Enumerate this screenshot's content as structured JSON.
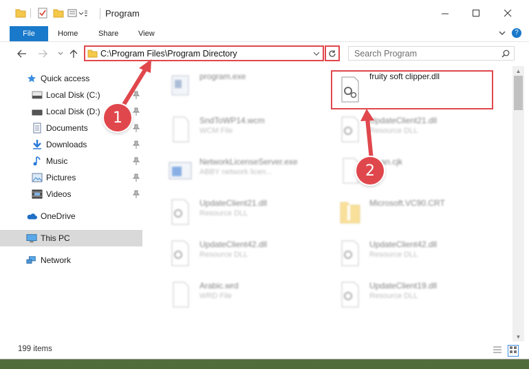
{
  "window": {
    "title": "Program"
  },
  "ribbon": {
    "tabs": [
      {
        "label": "File"
      },
      {
        "label": "Home"
      },
      {
        "label": "Share"
      },
      {
        "label": "View"
      }
    ]
  },
  "address": {
    "path": "C:\\Program Files\\Program Directory",
    "search_placeholder": "Search Program"
  },
  "nav": {
    "items": [
      {
        "label": "Quick access",
        "icon": "star-icon"
      },
      {
        "label": "Local Disk (C:)",
        "icon": "drive-icon"
      },
      {
        "label": "Local Disk (D:)",
        "icon": "drive-icon"
      },
      {
        "label": "Documents",
        "icon": "documents-icon"
      },
      {
        "label": "Downloads",
        "icon": "download-arrow-icon"
      },
      {
        "label": "Music",
        "icon": "music-note-icon"
      },
      {
        "label": "Pictures",
        "icon": "pictures-icon"
      },
      {
        "label": "Videos",
        "icon": "videos-icon"
      },
      {
        "label": "OneDrive",
        "icon": "cloud-icon"
      },
      {
        "label": "This PC",
        "icon": "computer-icon"
      },
      {
        "label": "Network",
        "icon": "network-icon"
      }
    ]
  },
  "files": [
    {
      "name": "program.exe",
      "type": ""
    },
    {
      "name": "fruity soft clipper.dll",
      "type": ""
    },
    {
      "name": "SndToWP14.wcm",
      "type": "WCM File"
    },
    {
      "name": "UpdateClient21.dll",
      "type": "Resource DLL"
    },
    {
      "name": "NetworkLicenseServer.exe",
      "type": "ABBY network licen..."
    },
    {
      "name": "...ean.cjk",
      "type": "...ile"
    },
    {
      "name": "UpdateClient21.dll",
      "type": "Resource DLL"
    },
    {
      "name": "Microsoft.VC90.CRT",
      "type": ""
    },
    {
      "name": "UpdateClient42.dll",
      "type": "Resource DLL"
    },
    {
      "name": "UpdateClient42.dll",
      "type": "Resource DLL"
    },
    {
      "name": "Arabic.wrd",
      "type": "WRD File"
    },
    {
      "name": "UpdateClient19.dll",
      "type": "Resource DLL"
    }
  ],
  "status": {
    "item_count": "199 items"
  },
  "annotations": {
    "marker1": "1",
    "marker2": "2"
  },
  "colors": {
    "accent": "#1979ca",
    "highlight": "#e0474c"
  }
}
